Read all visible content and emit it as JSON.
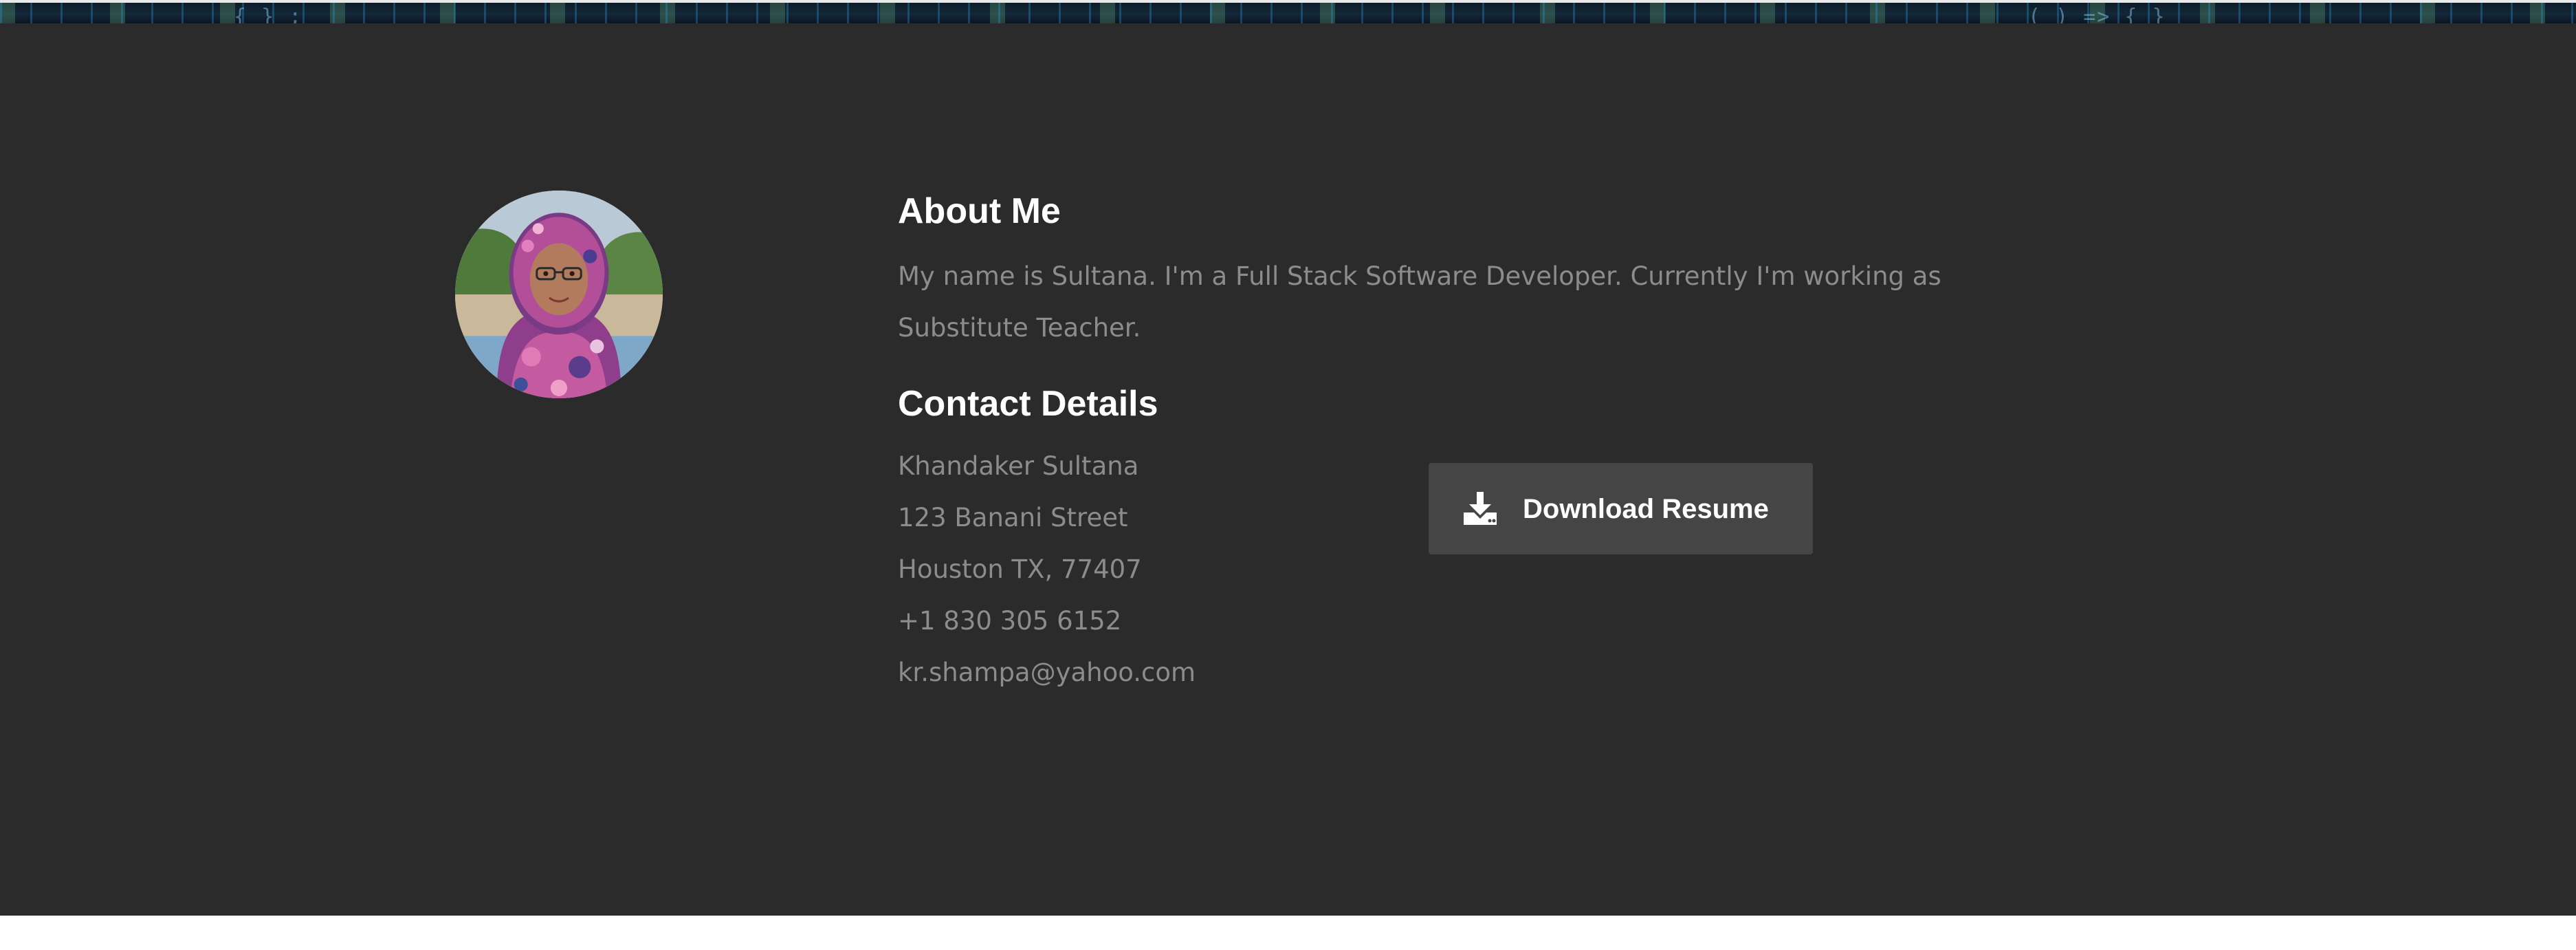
{
  "about": {
    "heading": "About Me",
    "text": "My name is Sultana. I'm a Full Stack Software Developer. Currently I'm working as Substitute Teacher."
  },
  "contact": {
    "heading": "Contact Details",
    "name": "Khandaker Sultana",
    "street": "123 Banani Street",
    "city": "Houston TX, 77407",
    "phone": "+1 830 305 6152",
    "email": "kr.shampa@yahoo.com"
  },
  "download": {
    "label": "Download Resume",
    "icon": "download-icon"
  },
  "colors": {
    "section_background": "#2b2b2b",
    "heading": "#ffffff",
    "body_text": "#8c8c8c",
    "button_background": "#454545"
  }
}
